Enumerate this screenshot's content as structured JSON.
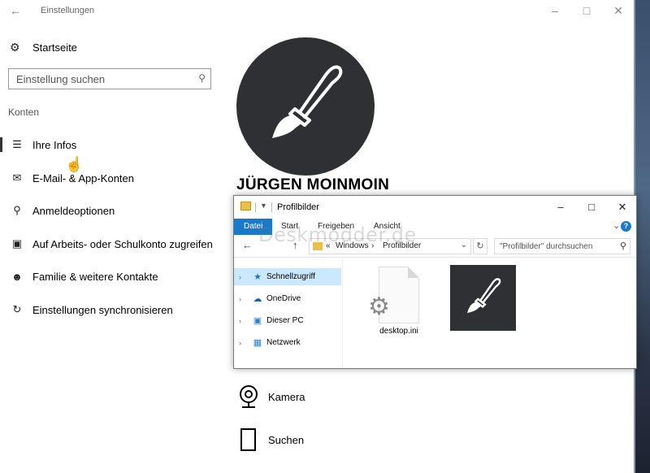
{
  "settings": {
    "title": "Einstellungen",
    "home_label": "Startseite",
    "search_placeholder": "Einstellung suchen",
    "section_label": "Konten",
    "nav": [
      {
        "label": "Ihre Infos",
        "icon": "person-card-icon",
        "selected": true
      },
      {
        "label": "E-Mail- & App-Konten",
        "icon": "mail-icon"
      },
      {
        "label": "Anmeldeoptionen",
        "icon": "key-icon"
      },
      {
        "label": "Auf Arbeits- oder Schulkonto zugreifen",
        "icon": "briefcase-icon"
      },
      {
        "label": "Familie & weitere Kontakte",
        "icon": "person-add-icon"
      },
      {
        "label": "Einstellungen synchronisieren",
        "icon": "sync-icon"
      }
    ],
    "user_name": "JÜRGEN MOINMOIN",
    "bottom": [
      {
        "label": "Kamera",
        "icon": "webcam-icon"
      },
      {
        "label": "Suchen",
        "icon": "document-icon"
      }
    ]
  },
  "explorer": {
    "title": "Profilbilder",
    "ribbon_tabs": [
      "Datei",
      "Start",
      "Freigeben",
      "Ansicht"
    ],
    "breadcrumb": [
      "Windows",
      "Profilbilder"
    ],
    "search_placeholder": "\"Profilbilder\" durchsuchen",
    "nav": [
      {
        "label": "Schnellzugriff",
        "icon": "star-icon",
        "selected": true
      },
      {
        "label": "OneDrive",
        "icon": "cloud-icon"
      },
      {
        "label": "Dieser PC",
        "icon": "monitor-icon"
      },
      {
        "label": "Netzwerk",
        "icon": "network-icon"
      }
    ],
    "files": [
      {
        "label": "desktop.ini",
        "icon": "settings-file-icon"
      },
      {
        "label": "",
        "icon": "brush-image-thumbnail"
      }
    ]
  },
  "watermark": "Deskmodder.de",
  "colors": {
    "avatar_bg": "#2f3033",
    "ribbon_file_tab": "#1979ca",
    "nav_selected": "#cce8ff"
  }
}
